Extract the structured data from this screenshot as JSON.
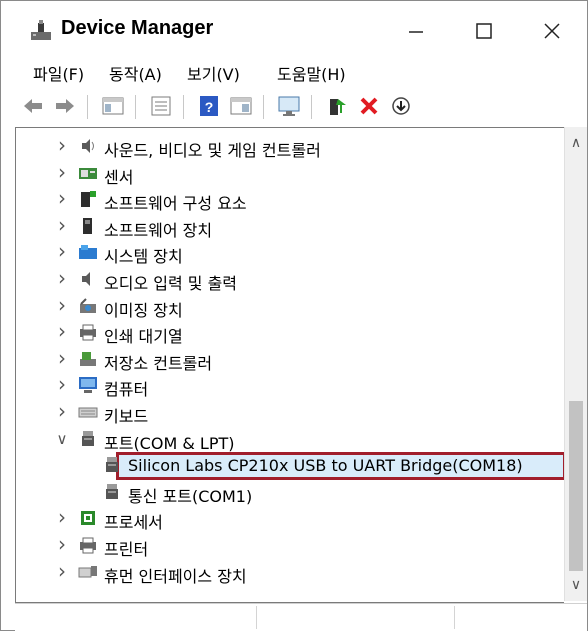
{
  "window": {
    "title": "Device Manager"
  },
  "menu": [
    "파일(F)",
    "동작(A)",
    "보기(V)",
    "도움말(H)"
  ],
  "tree": {
    "items": [
      {
        "label": "사운드, 비디오 및 게임 컨트롤러",
        "icon": "speaker-icon",
        "expanded": false
      },
      {
        "label": "센서",
        "icon": "sensor-icon",
        "expanded": false
      },
      {
        "label": "소프트웨어 구성 요소",
        "icon": "software-component-icon",
        "expanded": false
      },
      {
        "label": "소프트웨어 장치",
        "icon": "software-device-icon",
        "expanded": false
      },
      {
        "label": "시스템 장치",
        "icon": "system-devices-icon",
        "expanded": false
      },
      {
        "label": "오디오 입력 및 출력",
        "icon": "audio-io-icon",
        "expanded": false
      },
      {
        "label": "이미징 장치",
        "icon": "imaging-device-icon",
        "expanded": false
      },
      {
        "label": "인쇄 대기열",
        "icon": "print-queue-icon",
        "expanded": false
      },
      {
        "label": "저장소 컨트롤러",
        "icon": "storage-controller-icon",
        "expanded": false
      },
      {
        "label": "컴퓨터",
        "icon": "computer-icon",
        "expanded": false
      },
      {
        "label": "키보드",
        "icon": "keyboard-icon",
        "expanded": false
      },
      {
        "label": "포트(COM & LPT)",
        "icon": "port-icon",
        "expanded": true
      },
      {
        "label": "Silicon Labs CP210x USB to UART Bridge(COM18)",
        "icon": "port-icon",
        "child": true,
        "selected": true
      },
      {
        "label": "통신 포트(COM1)",
        "icon": "port-icon",
        "child": true
      },
      {
        "label": "프로세서",
        "icon": "processor-icon",
        "expanded": false
      },
      {
        "label": "프린터",
        "icon": "printer-icon",
        "expanded": false
      },
      {
        "label": "휴먼 인터페이스 장치",
        "icon": "hid-icon",
        "expanded": false
      }
    ]
  },
  "colors": {
    "selection_bg": "#d9ecfa",
    "highlight_border": "#a11e2b",
    "remove_red": "#e11b22"
  }
}
